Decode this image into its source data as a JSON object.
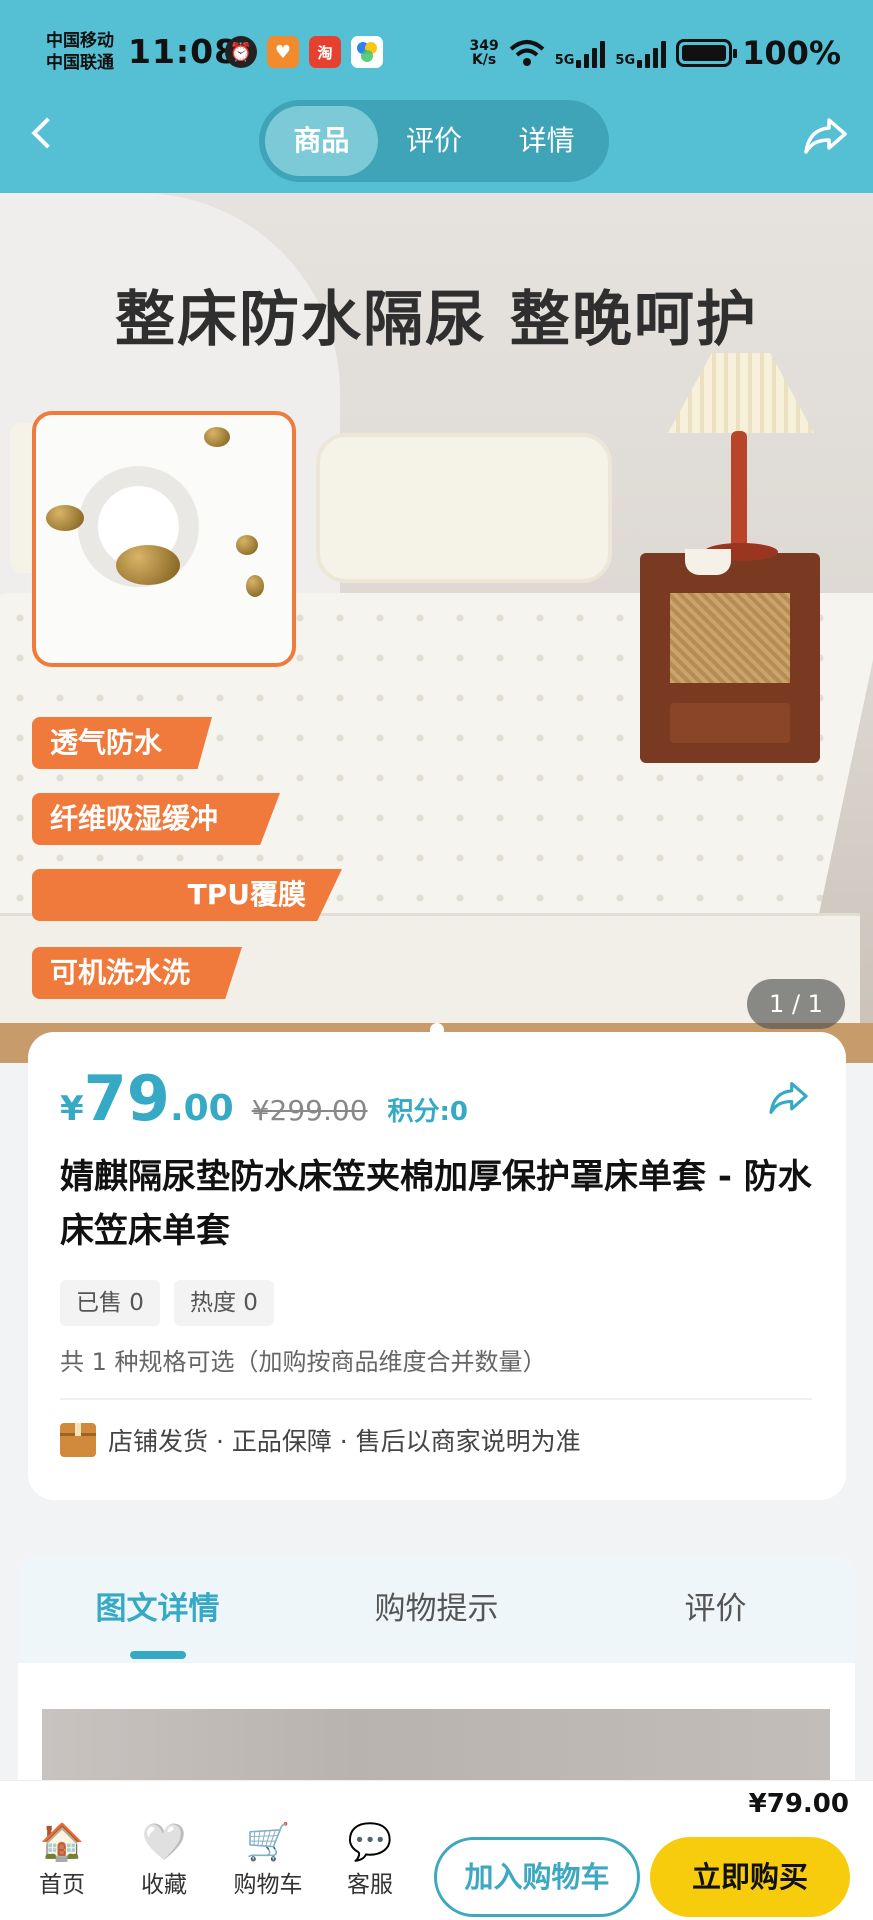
{
  "status_bar": {
    "carrier_1": "中国移动",
    "carrier_2": "中国联通",
    "time": "11:08",
    "net_speed_value": "349",
    "net_speed_unit": "K/s",
    "net_type_1": "5G",
    "net_type_2": "5G",
    "battery": "100%",
    "app_icons": [
      "alarm-icon",
      "heart-app-icon",
      "taobao-app-icon",
      "pinwheel-app-icon"
    ]
  },
  "header": {
    "tabs": [
      {
        "label": "商品",
        "active": true
      },
      {
        "label": "评价",
        "active": false
      },
      {
        "label": "详情",
        "active": false
      }
    ]
  },
  "hero": {
    "title": "整床防水隔尿 整晚呵护",
    "badges": [
      "透气防水",
      "纤维吸湿缓冲",
      "TPU覆膜",
      "可机洗水洗"
    ],
    "counter": "1 / 1"
  },
  "product": {
    "currency": "¥",
    "price_int": "79",
    "price_dec": ".00",
    "original_price": "¥299.00",
    "points": "积分:0",
    "title": "婧麒隔尿垫防水床笠夹棉加厚保护罩床单套 - 防水床笠床单套",
    "sold": "已售 0",
    "heat": "热度 0",
    "spec_text": "共 1 种规格可选（加购按商品维度合并数量）",
    "service_text": "店铺发货 · 正品保障 · 售后以商家说明为准"
  },
  "detail_tabs": [
    {
      "label": "图文详情",
      "active": true
    },
    {
      "label": "购物提示",
      "active": false
    },
    {
      "label": "评价",
      "active": false
    }
  ],
  "bottom_bar": {
    "nav": [
      {
        "label": "首页",
        "icon": "home-icon",
        "glyph": "🏠"
      },
      {
        "label": "收藏",
        "icon": "heart-icon",
        "glyph": "🤍"
      },
      {
        "label": "购物车",
        "icon": "cart-icon",
        "glyph": "🛒"
      },
      {
        "label": "客服",
        "icon": "chat-icon",
        "glyph": "💬"
      }
    ],
    "price": "¥79.00",
    "add_to_cart": "加入购物车",
    "buy_now": "立即购买"
  },
  "colors": {
    "header_bg": "#55bfd3",
    "accent": "#36aac4",
    "badge": "#f07a3c",
    "buy_button": "#f6cc0d"
  }
}
